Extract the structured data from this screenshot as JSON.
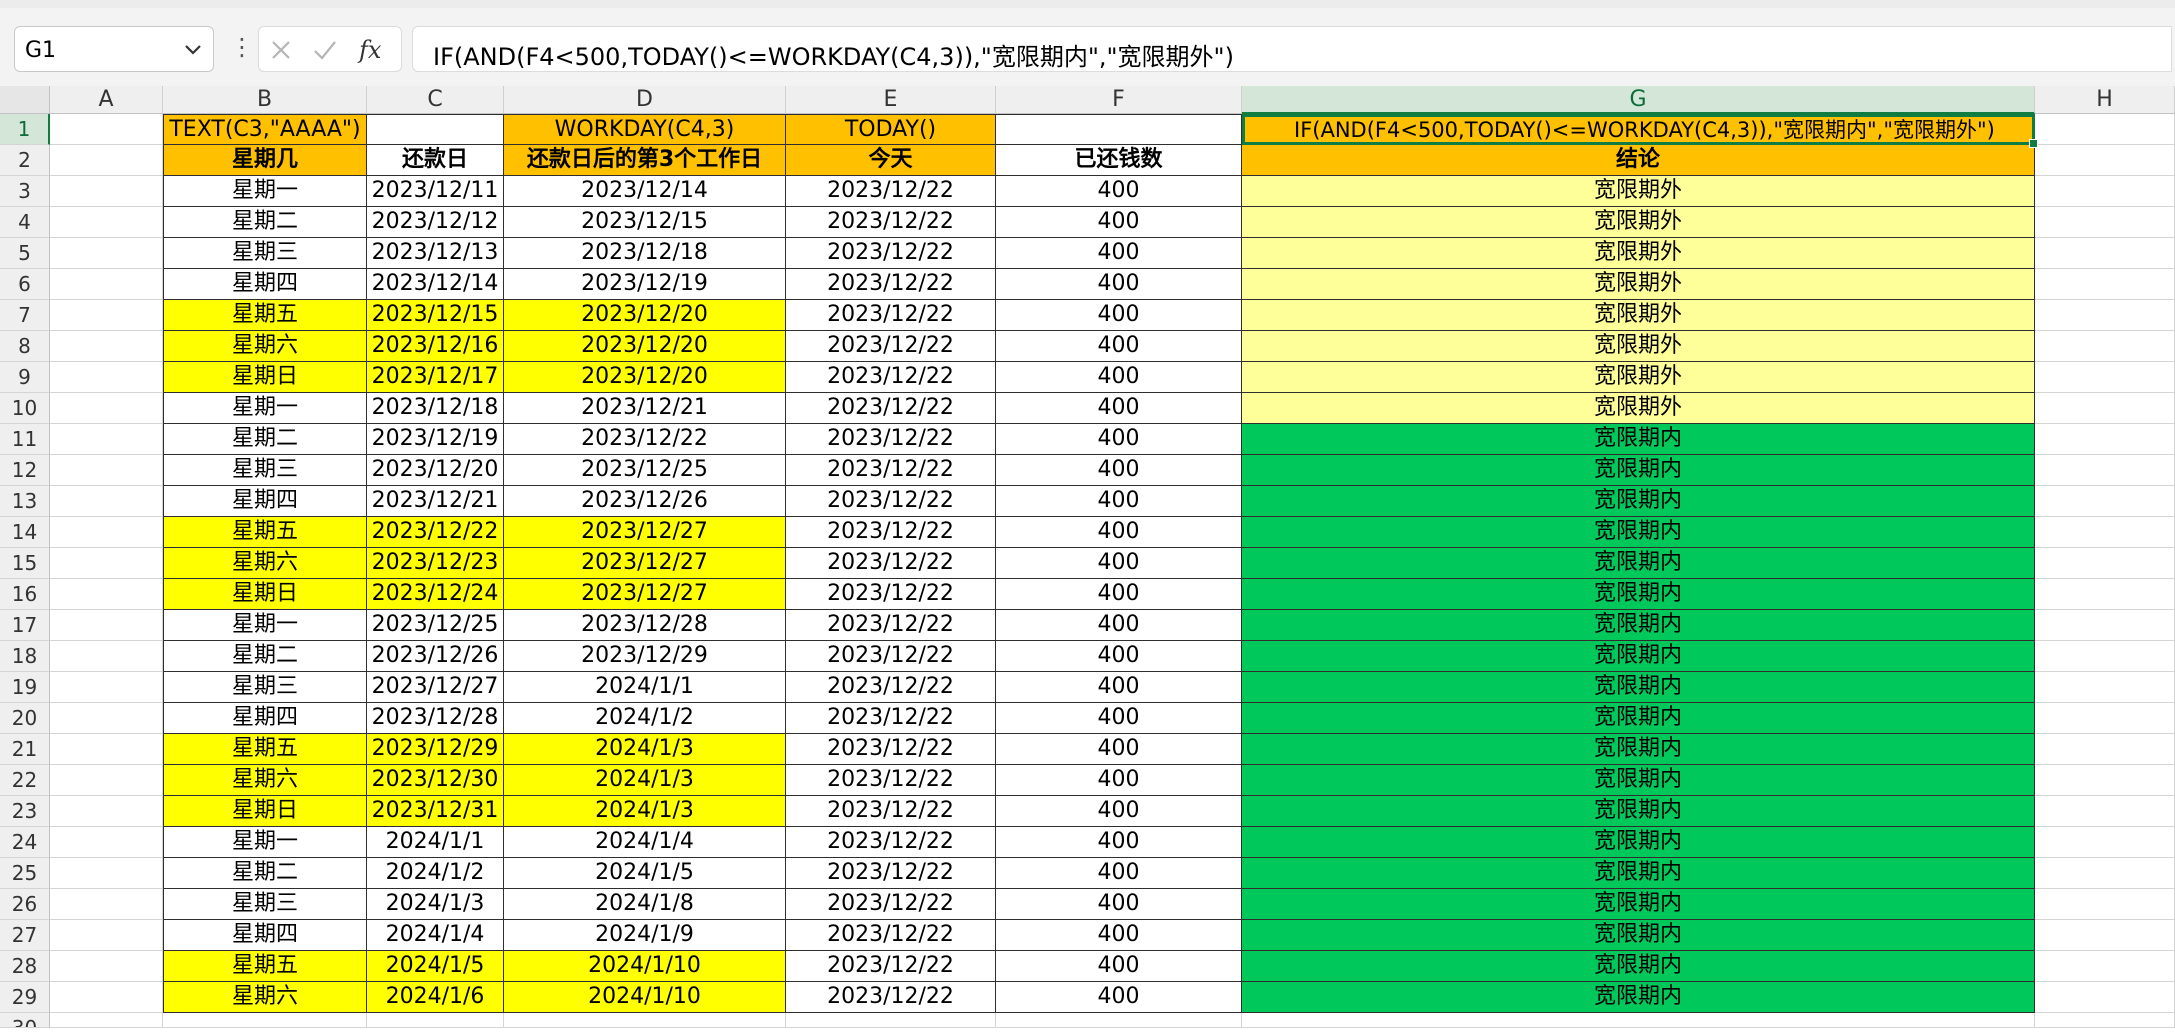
{
  "name_box": {
    "value": "G1"
  },
  "formula_bar": {
    "formula": "IF(AND(F4<500,TODAY()<=WORKDAY(C4,3)),\"宽限期内\",\"宽限期外\")"
  },
  "icons": {
    "name_box_dropdown": "chevron-down-icon",
    "bar_menu": "vertical-dots-icon",
    "cancel": "cancel-x-icon",
    "confirm": "checkmark-icon",
    "insert_function": "fx-icon"
  },
  "colors": {
    "header_orange": "#ffc000",
    "weekend_yellow": "#ffff00",
    "outside_grace": "#ffff99",
    "inside_grace": "#00c85a",
    "selection_green": "#107c41"
  },
  "sheet": {
    "columns": [
      "A",
      "B",
      "C",
      "D",
      "E",
      "F",
      "G",
      "H"
    ],
    "selected_column": "G",
    "selected_row": "1",
    "row1": {
      "B": "TEXT(C3,\"AAAA\")",
      "C": "",
      "D": "WORKDAY(C4,3)",
      "E": "TODAY()",
      "F": "",
      "G": "IF(AND(F4<500,TODAY()<=WORKDAY(C4,3)),\"宽限期内\",\"宽限期外\")"
    },
    "headers": {
      "B": "星期几",
      "C": "还款日",
      "D": "还款日后的第3个工作日",
      "E": "今天",
      "F": "已还钱数",
      "G": "结论"
    },
    "rows": [
      {
        "n": "3",
        "B": "星期一",
        "C": "2023/12/11",
        "D": "2023/12/14",
        "E": "2023/12/22",
        "F": "400",
        "G": "宽限期外",
        "weekend": false,
        "inside": false
      },
      {
        "n": "4",
        "B": "星期二",
        "C": "2023/12/12",
        "D": "2023/12/15",
        "E": "2023/12/22",
        "F": "400",
        "G": "宽限期外",
        "weekend": false,
        "inside": false
      },
      {
        "n": "5",
        "B": "星期三",
        "C": "2023/12/13",
        "D": "2023/12/18",
        "E": "2023/12/22",
        "F": "400",
        "G": "宽限期外",
        "weekend": false,
        "inside": false
      },
      {
        "n": "6",
        "B": "星期四",
        "C": "2023/12/14",
        "D": "2023/12/19",
        "E": "2023/12/22",
        "F": "400",
        "G": "宽限期外",
        "weekend": false,
        "inside": false
      },
      {
        "n": "7",
        "B": "星期五",
        "C": "2023/12/15",
        "D": "2023/12/20",
        "E": "2023/12/22",
        "F": "400",
        "G": "宽限期外",
        "weekend": true,
        "inside": false
      },
      {
        "n": "8",
        "B": "星期六",
        "C": "2023/12/16",
        "D": "2023/12/20",
        "E": "2023/12/22",
        "F": "400",
        "G": "宽限期外",
        "weekend": true,
        "inside": false
      },
      {
        "n": "9",
        "B": "星期日",
        "C": "2023/12/17",
        "D": "2023/12/20",
        "E": "2023/12/22",
        "F": "400",
        "G": "宽限期外",
        "weekend": true,
        "inside": false
      },
      {
        "n": "10",
        "B": "星期一",
        "C": "2023/12/18",
        "D": "2023/12/21",
        "E": "2023/12/22",
        "F": "400",
        "G": "宽限期外",
        "weekend": false,
        "inside": false
      },
      {
        "n": "11",
        "B": "星期二",
        "C": "2023/12/19",
        "D": "2023/12/22",
        "E": "2023/12/22",
        "F": "400",
        "G": "宽限期内",
        "weekend": false,
        "inside": true
      },
      {
        "n": "12",
        "B": "星期三",
        "C": "2023/12/20",
        "D": "2023/12/25",
        "E": "2023/12/22",
        "F": "400",
        "G": "宽限期内",
        "weekend": false,
        "inside": true
      },
      {
        "n": "13",
        "B": "星期四",
        "C": "2023/12/21",
        "D": "2023/12/26",
        "E": "2023/12/22",
        "F": "400",
        "G": "宽限期内",
        "weekend": false,
        "inside": true
      },
      {
        "n": "14",
        "B": "星期五",
        "C": "2023/12/22",
        "D": "2023/12/27",
        "E": "2023/12/22",
        "F": "400",
        "G": "宽限期内",
        "weekend": true,
        "inside": true
      },
      {
        "n": "15",
        "B": "星期六",
        "C": "2023/12/23",
        "D": "2023/12/27",
        "E": "2023/12/22",
        "F": "400",
        "G": "宽限期内",
        "weekend": true,
        "inside": true
      },
      {
        "n": "16",
        "B": "星期日",
        "C": "2023/12/24",
        "D": "2023/12/27",
        "E": "2023/12/22",
        "F": "400",
        "G": "宽限期内",
        "weekend": true,
        "inside": true
      },
      {
        "n": "17",
        "B": "星期一",
        "C": "2023/12/25",
        "D": "2023/12/28",
        "E": "2023/12/22",
        "F": "400",
        "G": "宽限期内",
        "weekend": false,
        "inside": true
      },
      {
        "n": "18",
        "B": "星期二",
        "C": "2023/12/26",
        "D": "2023/12/29",
        "E": "2023/12/22",
        "F": "400",
        "G": "宽限期内",
        "weekend": false,
        "inside": true
      },
      {
        "n": "19",
        "B": "星期三",
        "C": "2023/12/27",
        "D": "2024/1/1",
        "E": "2023/12/22",
        "F": "400",
        "G": "宽限期内",
        "weekend": false,
        "inside": true
      },
      {
        "n": "20",
        "B": "星期四",
        "C": "2023/12/28",
        "D": "2024/1/2",
        "E": "2023/12/22",
        "F": "400",
        "G": "宽限期内",
        "weekend": false,
        "inside": true
      },
      {
        "n": "21",
        "B": "星期五",
        "C": "2023/12/29",
        "D": "2024/1/3",
        "E": "2023/12/22",
        "F": "400",
        "G": "宽限期内",
        "weekend": true,
        "inside": true
      },
      {
        "n": "22",
        "B": "星期六",
        "C": "2023/12/30",
        "D": "2024/1/3",
        "E": "2023/12/22",
        "F": "400",
        "G": "宽限期内",
        "weekend": true,
        "inside": true
      },
      {
        "n": "23",
        "B": "星期日",
        "C": "2023/12/31",
        "D": "2024/1/3",
        "E": "2023/12/22",
        "F": "400",
        "G": "宽限期内",
        "weekend": true,
        "inside": true
      },
      {
        "n": "24",
        "B": "星期一",
        "C": "2024/1/1",
        "D": "2024/1/4",
        "E": "2023/12/22",
        "F": "400",
        "G": "宽限期内",
        "weekend": false,
        "inside": true
      },
      {
        "n": "25",
        "B": "星期二",
        "C": "2024/1/2",
        "D": "2024/1/5",
        "E": "2023/12/22",
        "F": "400",
        "G": "宽限期内",
        "weekend": false,
        "inside": true
      },
      {
        "n": "26",
        "B": "星期三",
        "C": "2024/1/3",
        "D": "2024/1/8",
        "E": "2023/12/22",
        "F": "400",
        "G": "宽限期内",
        "weekend": false,
        "inside": true
      },
      {
        "n": "27",
        "B": "星期四",
        "C": "2024/1/4",
        "D": "2024/1/9",
        "E": "2023/12/22",
        "F": "400",
        "G": "宽限期内",
        "weekend": false,
        "inside": true
      },
      {
        "n": "28",
        "B": "星期五",
        "C": "2024/1/5",
        "D": "2024/1/10",
        "E": "2023/12/22",
        "F": "400",
        "G": "宽限期内",
        "weekend": true,
        "inside": true
      },
      {
        "n": "29",
        "B": "星期六",
        "C": "2024/1/6",
        "D": "2024/1/10",
        "E": "2023/12/22",
        "F": "400",
        "G": "宽限期内",
        "weekend": true,
        "inside": true
      }
    ],
    "trailing_row": "30"
  }
}
